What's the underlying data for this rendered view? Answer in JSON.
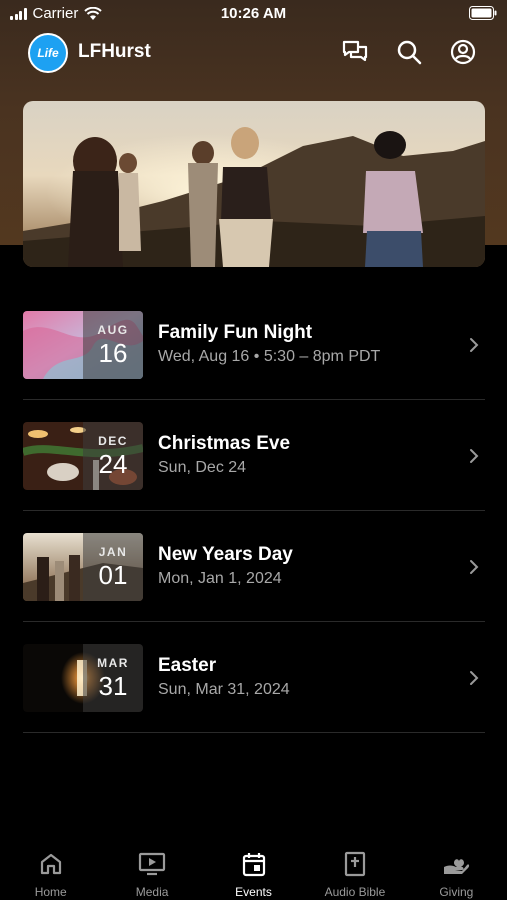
{
  "status_bar": {
    "carrier": "Carrier",
    "time": "10:26 AM"
  },
  "app_bar": {
    "logo_text": "Life",
    "title": "LFHurst"
  },
  "events": [
    {
      "month": "AUG",
      "day": "16",
      "title": "Family Fun Night",
      "subtitle": "Wed, Aug 16 • 5:30 – 8pm PDT"
    },
    {
      "month": "DEC",
      "day": "24",
      "title": "Christmas Eve",
      "subtitle": "Sun, Dec 24"
    },
    {
      "month": "JAN",
      "day": "01",
      "title": "New Years Day",
      "subtitle": "Mon, Jan 1, 2024"
    },
    {
      "month": "MAR",
      "day": "31",
      "title": "Easter",
      "subtitle": "Sun, Mar 31, 2024"
    }
  ],
  "tabs": [
    {
      "label": "Home",
      "icon": "home-icon",
      "active": false
    },
    {
      "label": "Media",
      "icon": "media-icon",
      "active": false
    },
    {
      "label": "Events",
      "icon": "calendar-icon",
      "active": true
    },
    {
      "label": "Audio Bible",
      "icon": "bible-icon",
      "active": false
    },
    {
      "label": "Giving",
      "icon": "giving-icon",
      "active": false
    }
  ],
  "colors": {
    "accent": "#1da1f2",
    "header": "#4a3320",
    "background": "#000000",
    "muted_text": "#a8a8a8"
  }
}
